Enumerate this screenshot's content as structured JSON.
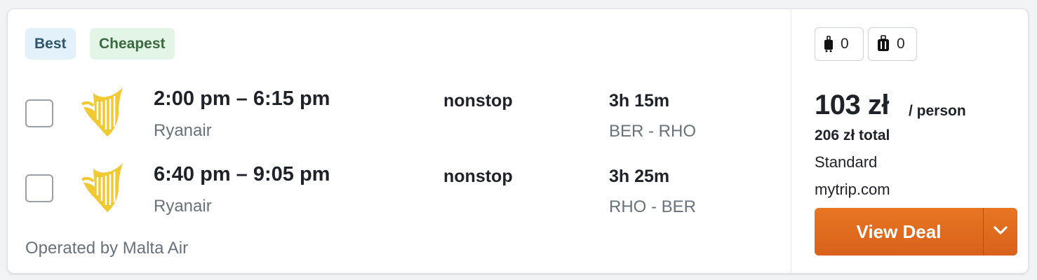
{
  "badges": {
    "best": "Best",
    "cheapest": "Cheapest"
  },
  "flights": [
    {
      "times": "2:00 pm – 6:15 pm",
      "airline": "Ryanair",
      "stops": "nonstop",
      "duration": "3h 15m",
      "route": "BER - RHO",
      "selected": false,
      "logo_icon": "ryanair-harp-icon"
    },
    {
      "times": "6:40 pm – 9:05 pm",
      "airline": "Ryanair",
      "stops": "nonstop",
      "duration": "3h 25m",
      "route": "RHO - BER",
      "selected": false,
      "logo_icon": "ryanair-harp-icon"
    }
  ],
  "operated_by": "Operated by Malta Air",
  "bags": {
    "carry_on": {
      "icon": "carry-on-bag-icon",
      "count": "0"
    },
    "checked": {
      "icon": "checked-bag-icon",
      "count": "0"
    }
  },
  "pricing": {
    "price": "103 zł",
    "per_person": "/ person",
    "total": "206 zł total",
    "fare_class": "Standard",
    "provider": "mytrip.com"
  },
  "cta": {
    "label": "View Deal",
    "dropdown_icon": "chevron-down-icon"
  },
  "colors": {
    "accent": "#e0691f",
    "best_badge_bg": "#e3f1fa",
    "cheapest_badge_bg": "#e3f5e6",
    "logo_yellow": "#f1c933"
  }
}
